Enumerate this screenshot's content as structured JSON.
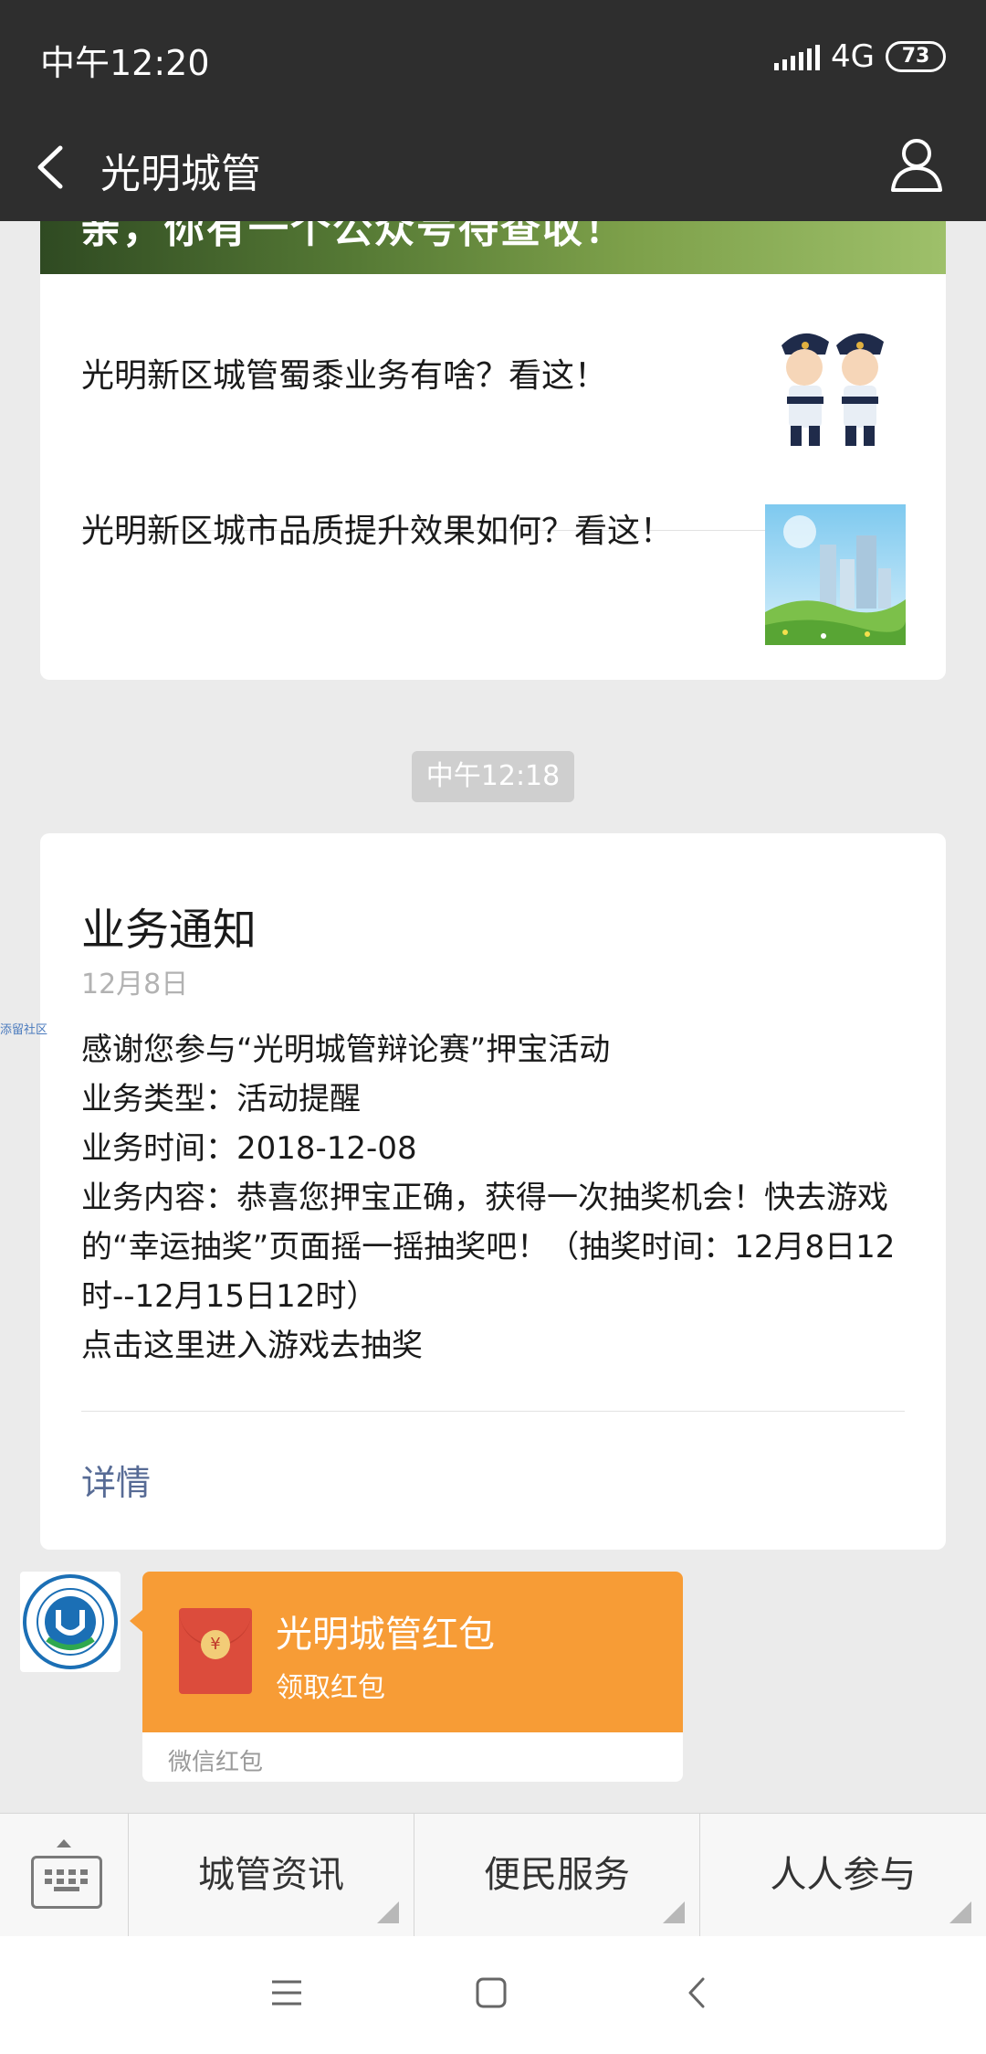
{
  "status_bar": {
    "time": "中午12:20",
    "network": "4G",
    "battery": "73"
  },
  "nav": {
    "title": "光明城管"
  },
  "article_card": {
    "banner_text": "亲，你有一个公众号待查收！",
    "items": [
      {
        "title": "光明新区城管蜀黍业务有啥？看这！",
        "thumb": "cartoon-officers-image"
      },
      {
        "title": "光明新区城市品质提升效果如何？看这！",
        "thumb": "city-park-image"
      }
    ]
  },
  "time_badge": "中午12:18",
  "notice": {
    "title": "业务通知",
    "date": "12月8日",
    "lines": [
      "感谢您参与“光明城管辩论赛”押宝活动",
      "业务类型：活动提醒",
      "业务时间：2018-12-08",
      "业务内容：恭喜您押宝正确，获得一次抽奖机会！快去游戏的“幸运抽奖”页面摇一摇抽奖吧！（抽奖时间：12月8日12时--12月15日12时）",
      "点击这里进入游戏去抽奖"
    ],
    "detail_link": "详情"
  },
  "side_tag": "添留社区",
  "red_packet": {
    "title": "光明城管红包",
    "subtitle": "领取红包",
    "footer": "微信红包",
    "coin_symbol": "¥"
  },
  "menu": {
    "items": [
      {
        "label": "城管资讯"
      },
      {
        "label": "便民服务"
      },
      {
        "label": "人人参与"
      }
    ]
  },
  "colors": {
    "top_bar": "#2e2e2e",
    "background": "#ebebeb",
    "red_packet": "#f79c36",
    "link": "#576b95"
  }
}
